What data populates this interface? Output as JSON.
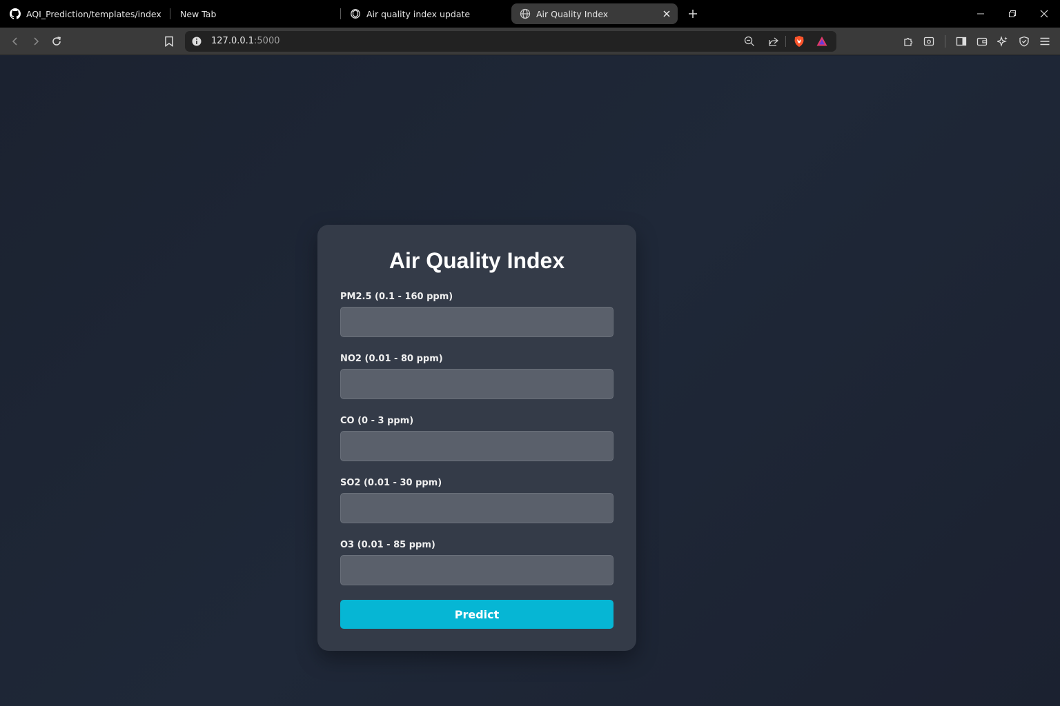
{
  "browser": {
    "tabs": [
      {
        "title": "AQI_Prediction/templates/index.html",
        "favicon": "github-icon",
        "active": false
      },
      {
        "title": "New Tab",
        "favicon": "none",
        "active": false
      },
      {
        "title": "Air quality index update",
        "favicon": "openai-icon",
        "active": false
      },
      {
        "title": "Air Quality Index",
        "favicon": "globe-icon",
        "active": true
      }
    ],
    "url_host": "127.0.0.1",
    "url_port": ":5000"
  },
  "page": {
    "title": "Air Quality Index",
    "fields": [
      {
        "label": "PM2.5 (0.1 - 160 ppm)",
        "value": "",
        "placeholder": ""
      },
      {
        "label": "NO2 (0.01 - 80 ppm)",
        "value": "",
        "placeholder": ""
      },
      {
        "label": "CO (0 - 3 ppm)",
        "value": "",
        "placeholder": ""
      },
      {
        "label": "SO2 (0.01 - 30 ppm)",
        "value": "",
        "placeholder": ""
      },
      {
        "label": "O3 (0.01 - 85 ppm)",
        "value": "",
        "placeholder": ""
      }
    ],
    "submit_label": "Predict"
  },
  "colors": {
    "page_background": "#1c2331",
    "card_background": "#343b48",
    "input_background": "#5a606b",
    "accent": "#06b6d4"
  }
}
